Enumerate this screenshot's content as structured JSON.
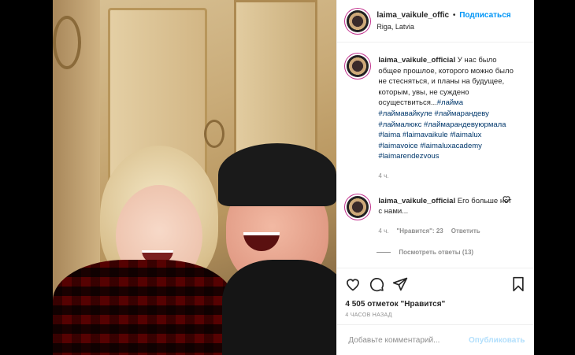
{
  "post": {
    "author": "laima_vaikule_offic",
    "dot": "•",
    "follow_label": "Подписаться",
    "location": "Riga, Latvia"
  },
  "caption": {
    "username": "laima_vaikule_official",
    "text": " У нас было общее прошлое, которого можно было не стесняться, и планы на будущее, которым, увы, не суждено осуществиться...",
    "hashtags": "#лайма #лаймавайкуле #лаймарандеву #лаймалюкс #лаймарандевуюрмала #laima #laimavaikule #laimalux #laimavoice #laimaluxacademy #laimarendezvous",
    "time": "4 ч."
  },
  "reply": {
    "username": "laima_vaikule_official",
    "text": " Его больше нет с нами...",
    "time": "4 ч.",
    "likes": "\"Нравится\": 23",
    "reply_label": "Ответить",
    "view_replies": "Посмотреть ответы (13)"
  },
  "actions": {
    "likes": "4 505 отметок \"Нравится\"",
    "ago": "4 часов назад"
  },
  "comment_box": {
    "placeholder": "Добавьте комментарий...",
    "publish": "Опубликовать"
  },
  "colors": {
    "accent": "#0095f6",
    "hashtag": "#00376b",
    "muted": "#8e8e8e"
  }
}
